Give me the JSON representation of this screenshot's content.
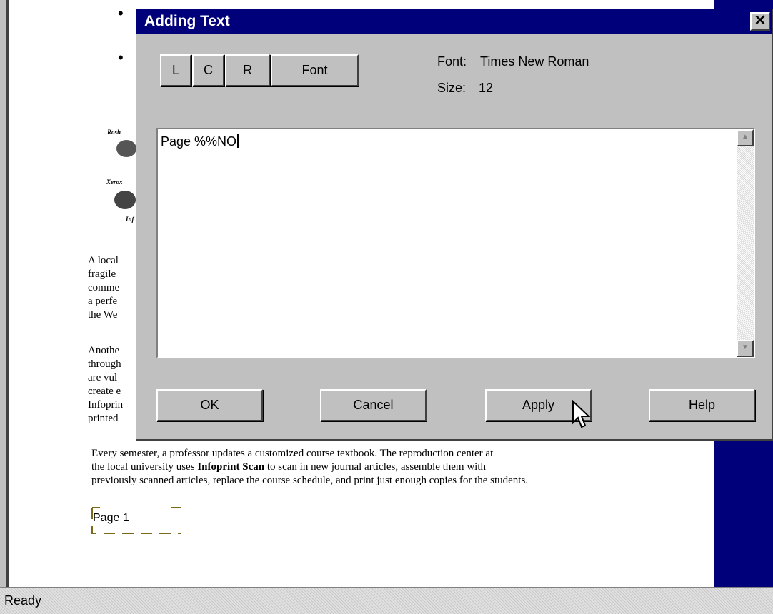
{
  "dialog": {
    "title": "Adding Text",
    "close_label": "✕",
    "align_left": "L",
    "align_center": "C",
    "align_right": "R",
    "font_button": "Font",
    "font_label": "Font:",
    "font_value": "Times New Roman",
    "size_label": "Size:",
    "size_value": "12",
    "text_value": "Page %%NO",
    "ok": "OK",
    "cancel": "Cancel",
    "apply": "Apply",
    "help": "Help"
  },
  "document": {
    "bullet": "•",
    "thumb_label_1": "Rosh",
    "thumb_label_2": "Xerox",
    "thumb_label_3": "Inf",
    "para1_lines": [
      "A local",
      "fragile",
      "comme",
      "a perfe",
      "the We"
    ],
    "para2_lines": [
      "Anothe",
      "through",
      "are vul",
      "create e",
      "Infoprin",
      "printed"
    ],
    "para3_line1": "Every semester, a professor updates a customized course textbook. The reproduction center at",
    "para3_line2_a": "the local university uses ",
    "para3_line2_bold": "Infoprint Scan",
    "para3_line2_b": " to scan in new journal articles, assemble them with",
    "para3_line3": "previously scanned articles, replace the course schedule, and print just enough copies for the students.",
    "page_label": "Page 1"
  },
  "statusbar": {
    "text": "Ready"
  },
  "colors": {
    "titlebar": "#00007b",
    "dialog_bg": "#c0c0c0",
    "page_frame": "#7b6a1a"
  },
  "icons": {
    "close": "close-icon",
    "scroll_up": "arrow-up-icon",
    "scroll_down": "arrow-down-icon",
    "cursor": "mouse-pointer-icon"
  }
}
